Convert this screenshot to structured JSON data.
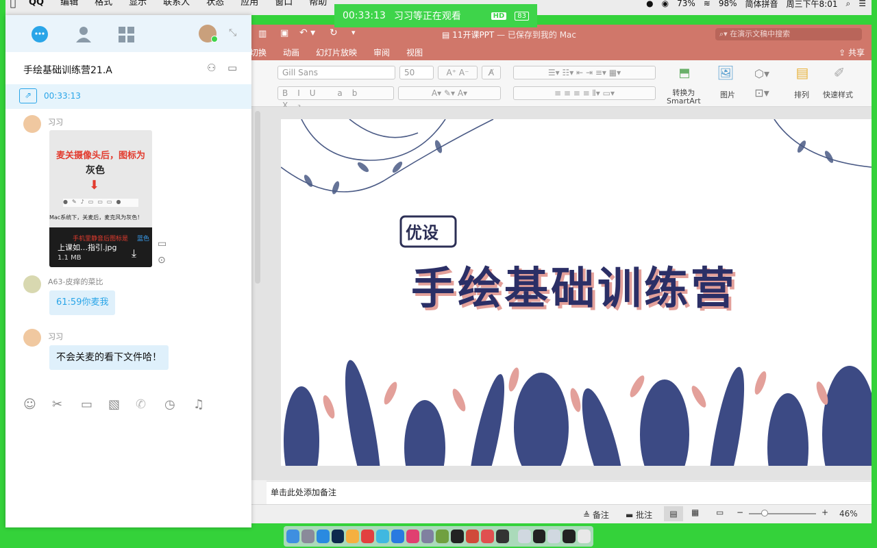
{
  "menubar": {
    "items": [
      "QQ",
      "编辑",
      "格式",
      "显示",
      "联系人",
      "状态",
      "应用",
      "窗口",
      "帮助"
    ],
    "battery_left": "73%",
    "battery": "98%",
    "input_method": "简体拼音",
    "clock": "周三下午8:01"
  },
  "banner": {
    "timer": "00:33:13",
    "text": "习习等正在观看",
    "hd": "HD",
    "count": "83"
  },
  "ppt": {
    "doc_title": "11开课PPT",
    "saved_status": "— 已保存到我的 Mac",
    "search_placeholder": "在演示文稿中搜索",
    "share": "共享",
    "tabs": [
      "切换",
      "动画",
      "幻灯片放映",
      "审阅",
      "视图"
    ],
    "font_name": "Gill Sans",
    "font_size": "50",
    "smartart_label_1": "转换为",
    "smartart_label_2": "SmartArt",
    "picture_label": "图片",
    "arrange_label": "排列",
    "quickstyle_label": "快速样式",
    "slide_title": "手绘基础训练营",
    "slide_badge": "优设",
    "notes_placeholder": "单击此处添加备注",
    "status_notes": "备注",
    "status_comments": "批注",
    "zoom": "46%"
  },
  "qq": {
    "chat_title": "手绘基础训练营21.A",
    "share_timer": "00:33:13",
    "messages": [
      {
        "sender": "习习",
        "type": "file",
        "thumb_line1": "麦关摄像头后，图标为",
        "thumb_line2": "灰色",
        "thumb_caption": "Mac系统下，关麦后，麦克风为灰色！",
        "thumb_red": "手机里静音后图标是",
        "thumb_blue": "蓝色",
        "file_name": "上课如…指引.jpg",
        "file_size": "1.1 MB"
      },
      {
        "sender": "A63-皮痒的菜比",
        "type": "text",
        "text": "61:59你麦我"
      },
      {
        "sender": "习习",
        "type": "text",
        "text": "不会关麦的看下文件哈！"
      }
    ]
  },
  "colors": {
    "accent_green": "#3ed44a",
    "ppt_red": "#d0776a",
    "qq_blue": "#2aa5e8",
    "bubble": "#dff0fb"
  }
}
